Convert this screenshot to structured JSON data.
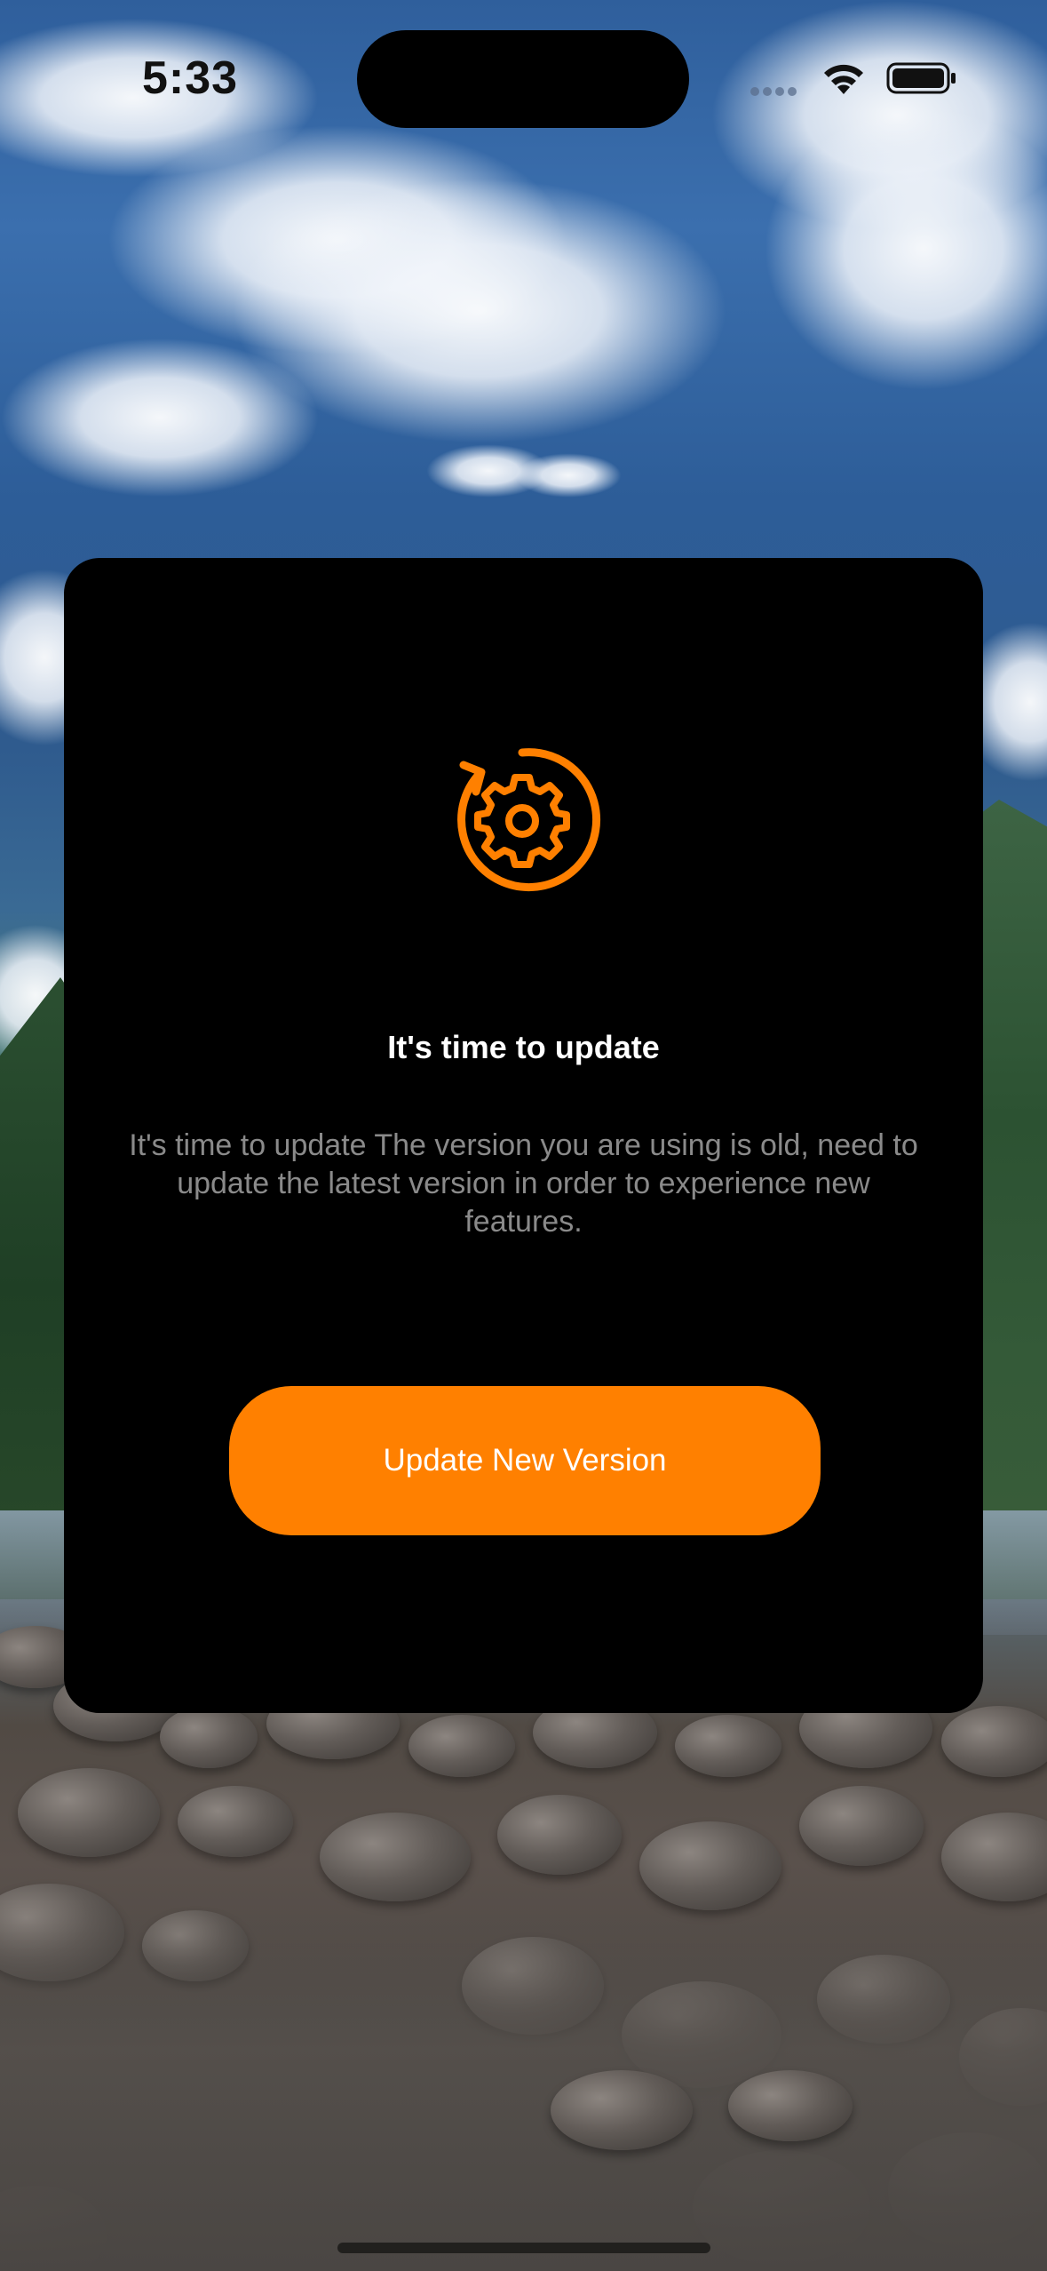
{
  "status_bar": {
    "time": "5:33",
    "wifi_icon": "wifi-icon",
    "battery_icon": "battery-icon"
  },
  "dialog": {
    "icon": "update-gear-icon",
    "title": "It's time to update",
    "message": "It's time to update The version you are using is old, need to update the latest version in order to experience new features.",
    "button_label": "Update New Version"
  },
  "colors": {
    "accent": "#ff8000",
    "dialog_background": "#000000",
    "title_text": "#ffffff",
    "message_text": "#8a8a8a"
  }
}
